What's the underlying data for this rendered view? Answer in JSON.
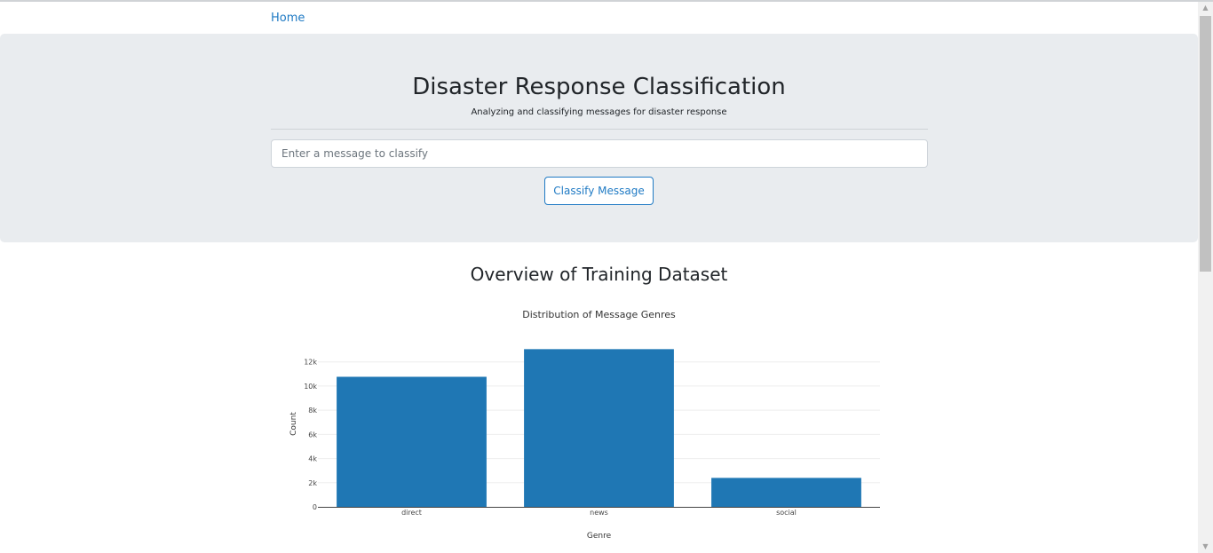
{
  "navbar": {
    "home_label": "Home"
  },
  "hero": {
    "title": "Disaster Response Classification",
    "subtitle": "Analyzing and classifying messages for disaster response",
    "input_placeholder": "Enter a message to classify",
    "button_label": "Classify Message"
  },
  "section": {
    "title": "Overview of Training Dataset"
  },
  "chart_data": {
    "type": "bar",
    "title": "Distribution of Message Genres",
    "xlabel": "Genre",
    "ylabel": "Count",
    "categories": [
      "direct",
      "news",
      "social"
    ],
    "values": [
      10766,
      13054,
      2396
    ],
    "ylim": [
      0,
      13741
    ],
    "yticks": [
      0,
      2000,
      4000,
      6000,
      8000,
      10000,
      12000
    ],
    "ytick_labels": [
      "0",
      "2k",
      "4k",
      "6k",
      "8k",
      "10k",
      "12k"
    ],
    "grid": true,
    "bar_color": "#1f77b4"
  },
  "colors": {
    "link": "#1f7ac4",
    "jumbotron_bg": "#e9ecef",
    "bar": "#1f77b4"
  }
}
